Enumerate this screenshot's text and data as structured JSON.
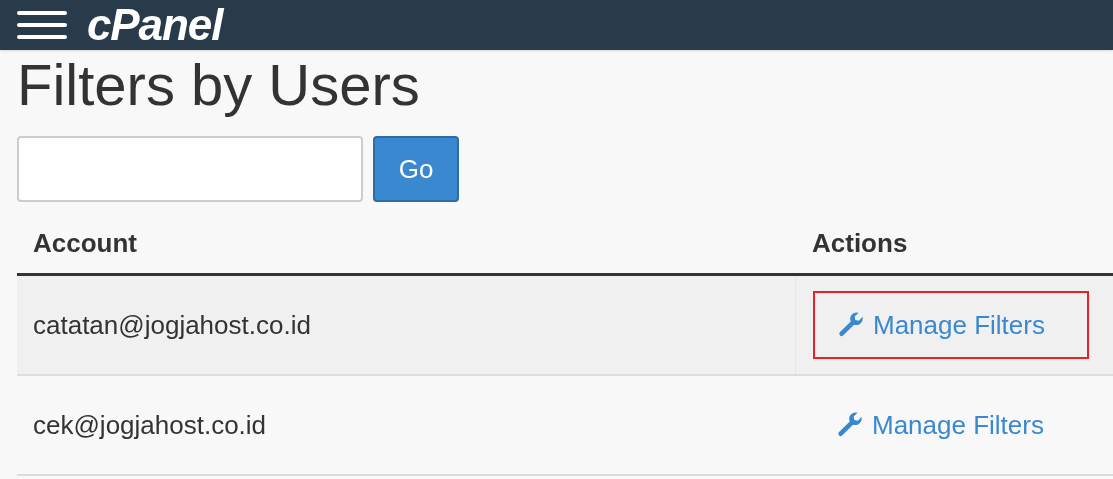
{
  "header": {
    "logo": "cPanel"
  },
  "page_title": "Filters by Users",
  "search": {
    "button": "Go"
  },
  "table": {
    "columns": [
      "Account",
      "Actions"
    ],
    "rows": [
      {
        "account": "catatan@jogjahost.co.id",
        "action": "Manage Filters",
        "highlighted": true,
        "selected": true
      },
      {
        "account": "cek@jogjahost.co.id",
        "action": "Manage Filters",
        "highlighted": false,
        "selected": false
      }
    ]
  }
}
